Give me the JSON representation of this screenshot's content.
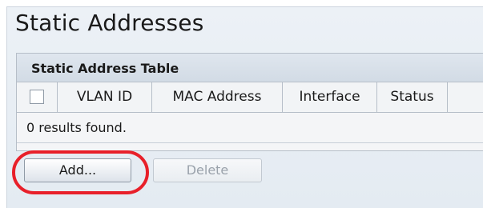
{
  "page": {
    "title": "Static Addresses"
  },
  "table": {
    "caption": "Static Address Table",
    "columns": [
      "VLAN ID",
      "MAC Address",
      "Interface",
      "Status"
    ],
    "results_text": "0 results found."
  },
  "buttons": {
    "add_label": "Add...",
    "delete_label": "Delete"
  },
  "colors": {
    "highlight": "#e8202a",
    "panel_bg": "#e8eef4",
    "caption_bg": "#d8e0e9"
  }
}
